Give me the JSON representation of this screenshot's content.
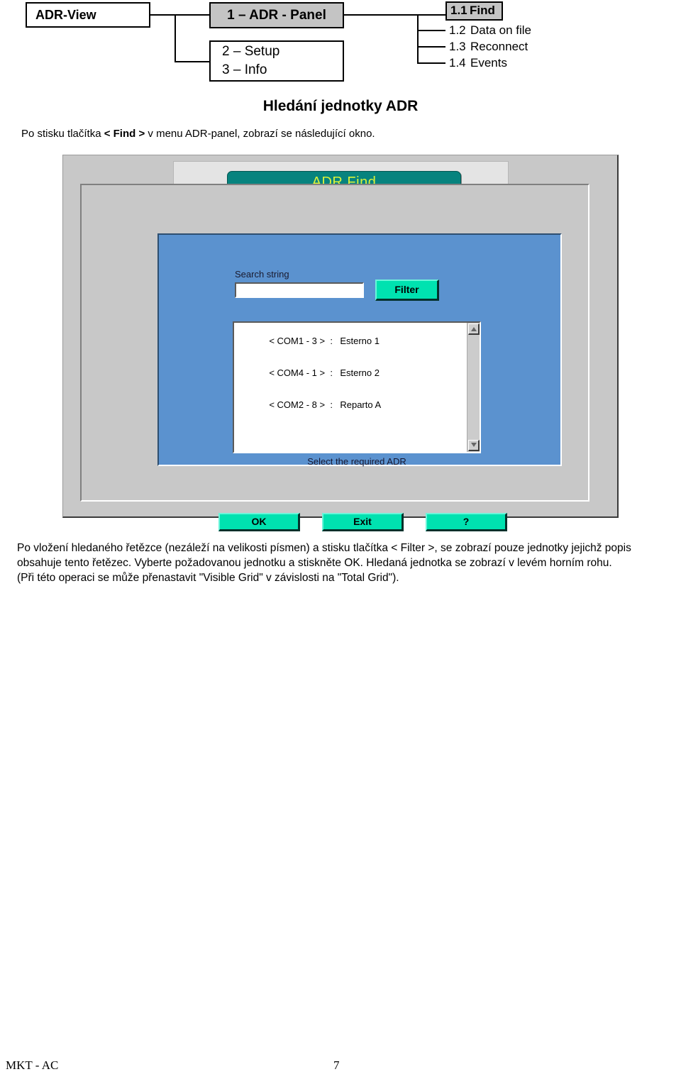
{
  "diagram": {
    "root_box": {
      "label": "ADR-View"
    },
    "panel_box": {
      "label": "1 – ADR - Panel"
    },
    "setup_box": {
      "line1": "2 – Setup",
      "line2": "3 – Info"
    },
    "submenu": [
      {
        "num": "1.1",
        "label": "Find",
        "highlighted": true
      },
      {
        "num": "1.2",
        "label": "Data on file",
        "highlighted": false
      },
      {
        "num": "1.3",
        "label": "Reconnect",
        "highlighted": false
      },
      {
        "num": "1.4",
        "label": "Events",
        "highlighted": false
      }
    ]
  },
  "heading": "Hledání jednotky ADR",
  "intro": {
    "before": "Po stisku tlačítka ",
    "bold": "< Find >",
    "after": " v menu ADR-panel, zobrazí se následující okno."
  },
  "dialog": {
    "title": "ADR Find",
    "search_label": "Search string",
    "search_value": "",
    "search_placeholder": "",
    "filter_button": "Filter",
    "list_items": [
      {
        "port": "< COM1 - 3 >",
        "colon": ":",
        "name": "Esterno 1"
      },
      {
        "port": "< COM4 - 1 >",
        "colon": ":",
        "name": "Esterno 2"
      },
      {
        "port": "< COM2 - 8 >",
        "colon": ":",
        "name": "Reparto A"
      }
    ],
    "hint": "Select the required ADR",
    "buttons": [
      {
        "label": "OK"
      },
      {
        "label": "Exit"
      },
      {
        "label": "?"
      }
    ],
    "colors": {
      "title_pill_bg": "#07837e",
      "title_pill_text": "#d9f23a",
      "client_bg": "#5b92cf",
      "button_bg": "#00e2b0",
      "frame_bg": "#c8c8c8"
    }
  },
  "paragraph": {
    "line1": "Po vložení hledaného řetězce (nezáleží na velikosti písmen) a stisku tlačítka < Filter >, se zobrazí pouze jednotky jejichž popis",
    "line2": "obsahuje tento řetězec. Vyberte požadovanou jednotku a stiskněte OK. Hledaná jednotka se zobrazí v levém horním rohu.",
    "line3": "(Při této operaci se může přenastavit \"Visible Grid\" v závislosti na \"Total Grid\")."
  },
  "footer": {
    "left": "MKT - AC",
    "page": "7"
  }
}
